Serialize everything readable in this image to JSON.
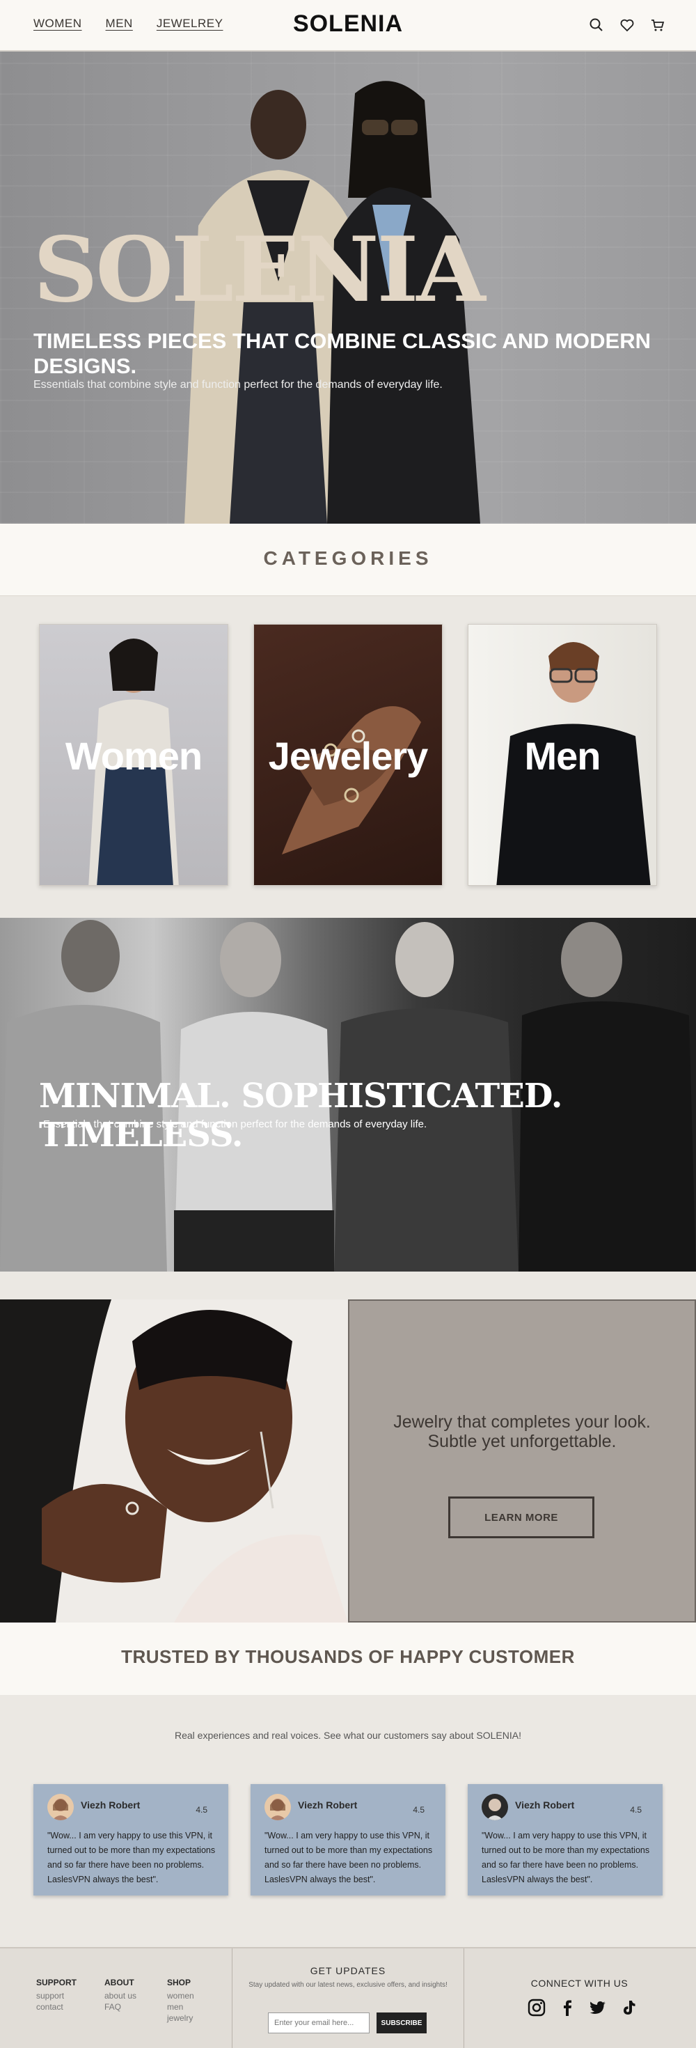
{
  "header": {
    "nav": [
      "WOMEN",
      "MEN",
      "JEWELREY"
    ],
    "logo": "SOLENIA",
    "icons": [
      "search-icon",
      "heart-icon",
      "cart-icon"
    ]
  },
  "hero": {
    "title": "SOLENIA",
    "subtitle": "TIMELESS PIECES THAT COMBINE CLASSIC AND MODERN DESIGNS.",
    "description": "Essentials that combine style and function perfect for the demands of everyday life."
  },
  "categories": {
    "heading": "CATEGORIES",
    "items": [
      {
        "label": "Women"
      },
      {
        "label": "Jewelery"
      },
      {
        "label": "Men"
      }
    ]
  },
  "banner": {
    "title": "MINIMAL. SOPHISTICATED. TIMELESS.",
    "description": "Essentials that combine style and function perfect for the demands of everyday life."
  },
  "jewelry": {
    "text": "Jewelry that completes your look. Subtle yet unforgettable.",
    "button": "LEARN MORE"
  },
  "trust": {
    "heading": "TRUSTED BY THOUSANDS OF HAPPY CUSTOMER",
    "subtitle": "Real experiences and real voices. See what our customers say about SOLENIA!",
    "reviews": [
      {
        "name": "Viezh Robert",
        "score": "4.5",
        "text": "\"Wow... I am very happy to use this VPN, it turned out to be more than my expectations and so far there have been no problems. LaslesVPN always the best\"."
      },
      {
        "name": "Viezh Robert",
        "score": "4.5",
        "text": "\"Wow... I am very happy to use this VPN, it turned out to be more than my expectations and so far there have been no problems. LaslesVPN always the best\"."
      },
      {
        "name": "Viezh Robert",
        "score": "4.5",
        "text": "\"Wow... I am very happy to use this VPN, it turned out to be more than my expectations and so far there have been no problems. LaslesVPN always the best\"."
      }
    ]
  },
  "footer": {
    "support": {
      "title": "SUPPORT",
      "links": [
        "support",
        "contact"
      ]
    },
    "about": {
      "title": "ABOUT",
      "links": [
        "about us",
        "FAQ"
      ]
    },
    "shop": {
      "title": "SHOP",
      "links": [
        "women",
        "men",
        "jewelry"
      ]
    },
    "updates": {
      "title": "GET UPDATES",
      "text": "Stay updated with our latest news, exclusive offers, and insights!",
      "placeholder": "Enter your email here...",
      "button": "SUBSCRIBE"
    },
    "connect": "CONNECT WITH US",
    "social": [
      "instagram-icon",
      "facebook-icon",
      "twitter-icon",
      "tiktok-icon"
    ]
  }
}
